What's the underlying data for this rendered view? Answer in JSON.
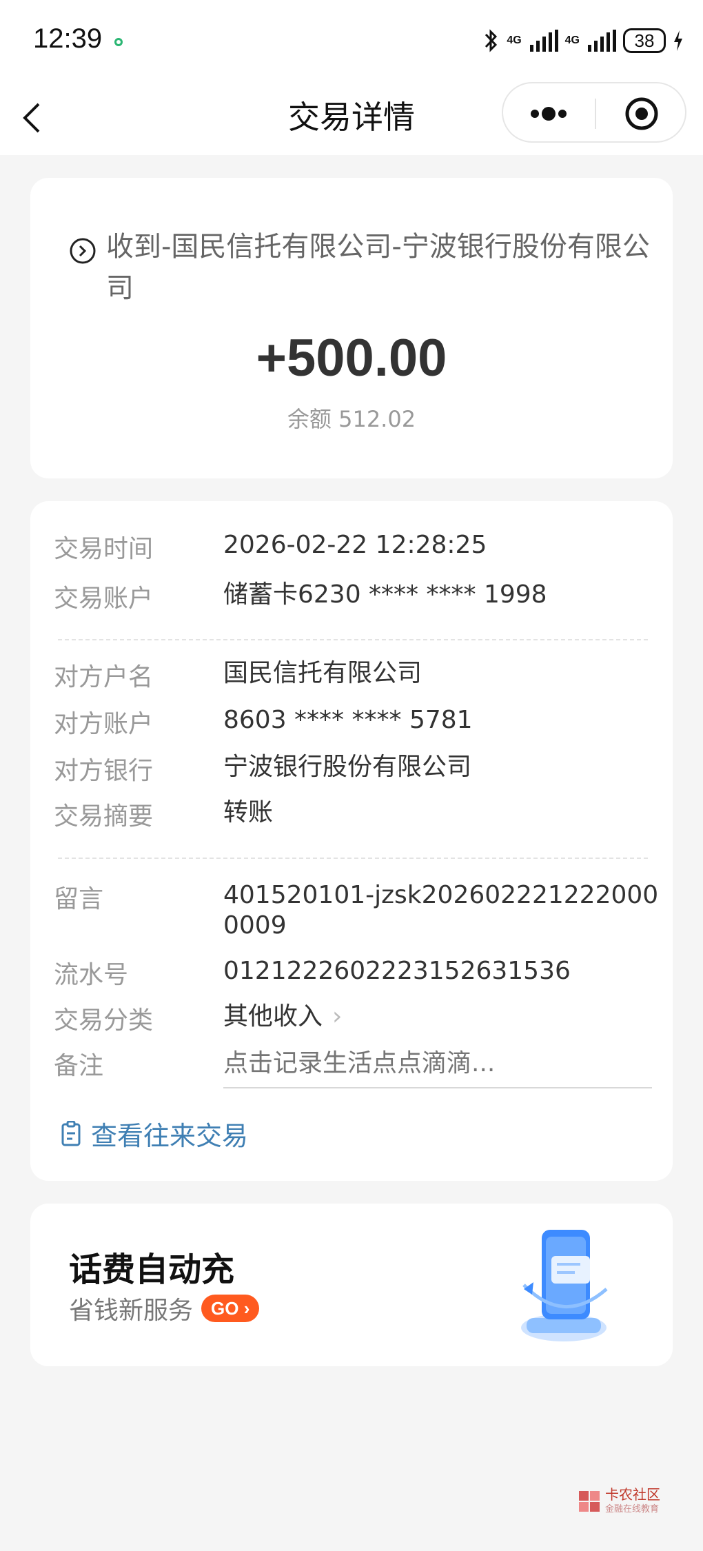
{
  "status": {
    "time": "12:39",
    "net1": "4G",
    "net2": "4G",
    "battery": "38"
  },
  "nav": {
    "title": "交易详情"
  },
  "summary": {
    "title": "收到-国民信托有限公司-宁波银行股份有限公司",
    "amount": "+500.00",
    "balance": "余额 512.02"
  },
  "details": {
    "time_label": "交易时间",
    "time_value": "2026-02-22 12:28:25",
    "account_label": "交易账户",
    "account_value": "储蓄卡6230 **** **** 1998",
    "payee_label": "对方户名",
    "payee_value": "国民信托有限公司",
    "payee_acct_label": "对方账户",
    "payee_acct_value": "8603 **** **** 5781",
    "bank_label": "对方银行",
    "bank_value": "宁波银行股份有限公司",
    "summary_label": "交易摘要",
    "summary_value": "转账",
    "message_label": "留言",
    "message_value": "401520101-jzsk2026022212220000009",
    "serial_label": "流水号",
    "serial_value": "01212226022231526315 36",
    "category_label": "交易分类",
    "category_value": "其他收入",
    "remark_label": "备注",
    "remark_placeholder": "点击记录生活点点滴滴...",
    "history_link": "查看往来交易"
  },
  "promo": {
    "title": "话费自动充",
    "subtitle": "省钱新服务",
    "badge": "GO"
  },
  "watermark": {
    "name": "卡农社区",
    "sub": "金融在线教育"
  }
}
